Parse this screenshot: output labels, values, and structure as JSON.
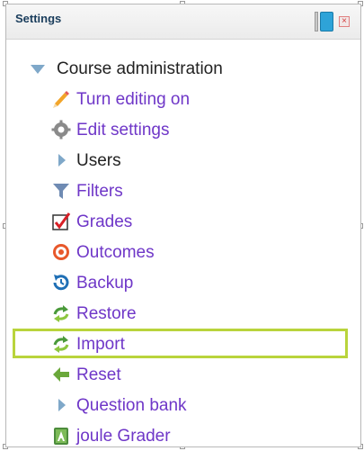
{
  "block": {
    "title": "Settings",
    "dock_icon": "dock-to-side-icon",
    "close_icon": "close-icon",
    "close_glyph": "×"
  },
  "tree": {
    "root_label": "Course administration",
    "items": [
      {
        "label": "Turn editing on",
        "icon": "pencil-icon",
        "link": true
      },
      {
        "label": "Edit settings",
        "icon": "gear-icon",
        "link": true
      },
      {
        "label": "Users",
        "icon": "expand-arrow-icon",
        "link": false
      },
      {
        "label": "Filters",
        "icon": "funnel-icon",
        "link": true
      },
      {
        "label": "Grades",
        "icon": "checkmark-icon",
        "link": true
      },
      {
        "label": "Outcomes",
        "icon": "target-icon",
        "link": true
      },
      {
        "label": "Backup",
        "icon": "backup-icon",
        "link": true
      },
      {
        "label": "Restore",
        "icon": "restore-icon",
        "link": true
      },
      {
        "label": "Import",
        "icon": "import-icon",
        "link": true,
        "highlighted": true
      },
      {
        "label": "Reset",
        "icon": "reset-arrow-icon",
        "link": true
      },
      {
        "label": "Question bank",
        "icon": "expand-arrow-icon",
        "link": true
      },
      {
        "label": "joule Grader",
        "icon": "joule-grader-icon",
        "link": true
      }
    ]
  },
  "colors": {
    "link": "#6f37c8",
    "highlight_border": "#b9d43c",
    "header_title": "#1a3d5c"
  }
}
